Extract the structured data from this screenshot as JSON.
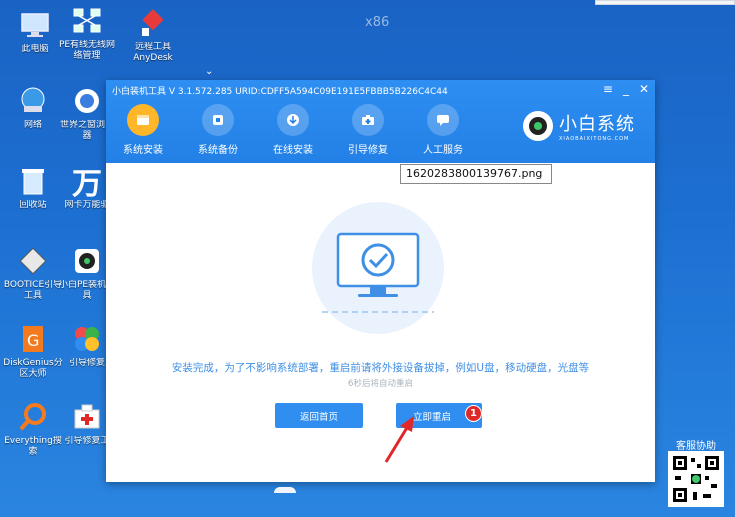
{
  "desktop": {
    "watermark": "x86",
    "icons": [
      {
        "label": "此电脑",
        "icon": "computer-icon"
      },
      {
        "label": "PE有线无线网络管理",
        "icon": "network-manager-icon"
      },
      {
        "label": "远程工具AnyDesk",
        "icon": "anydesk-icon"
      },
      {
        "label": "网络",
        "icon": "network-icon"
      },
      {
        "label": "世界之窗浏览器",
        "icon": "browser-icon"
      },
      {
        "label": "回收站",
        "icon": "recycle-bin-icon"
      },
      {
        "label": "网卡万能驱",
        "icon": "driver-icon"
      },
      {
        "label": "BOOTICE引导工具",
        "icon": "bootice-icon"
      },
      {
        "label": "小白PE装机工具",
        "icon": "xiaobai-pe-icon"
      },
      {
        "label": "DiskGenius分区大师",
        "icon": "diskgenius-icon"
      },
      {
        "label": "引导修复",
        "icon": "boot-repair-icon"
      },
      {
        "label": "Everything搜索",
        "icon": "everything-search-icon"
      },
      {
        "label": "引导修复工",
        "icon": "boot-repair-tool-icon"
      }
    ],
    "help_label": "客服协助"
  },
  "window": {
    "title": "小白装机工具 V 3.1.572.285 URID:CDFF5A594C09E191E5FBBB5B226C4C44",
    "tabs": [
      {
        "label": "系统安装",
        "icon": "system-install-icon",
        "active": true
      },
      {
        "label": "系统备份",
        "icon": "system-backup-icon",
        "active": false
      },
      {
        "label": "在线安装",
        "icon": "online-install-icon",
        "active": false
      },
      {
        "label": "引导修复",
        "icon": "boot-repair-icon",
        "active": false
      },
      {
        "label": "人工服务",
        "icon": "chat-icon",
        "active": false
      }
    ],
    "brand": {
      "name": "小白系统",
      "sub": "XIAOBAIXITONG.COM"
    },
    "message": "安装完成，为了不影响系统部署，重启前请将外接设备拔掉，例如U盘，移动硬盘，光盘等",
    "countdown": "6秒后将自动重启",
    "buttons": {
      "home": "返回首页",
      "reboot": "立即重启"
    },
    "badge": "1"
  },
  "tooltip": {
    "filename": "1620283800139767.png"
  },
  "colors": {
    "accent": "#2f8ef0",
    "header": "#2380e6",
    "active_tab": "#ffb629",
    "badge": "#e02828"
  }
}
